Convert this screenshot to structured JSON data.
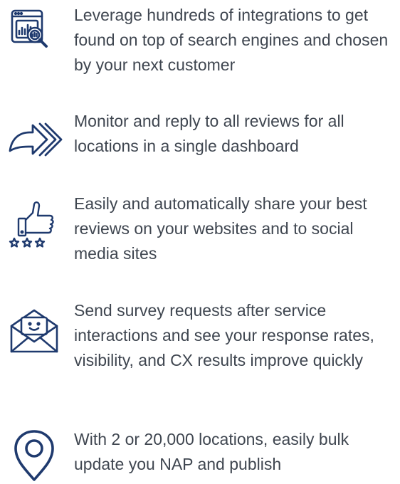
{
  "features": [
    {
      "icon": "analytics-search-icon",
      "text": "Leverage hundreds of integrations to get found on top of search engines and chosen by your next customer"
    },
    {
      "icon": "reply-arrow-icon",
      "text": "Monitor and reply to all reviews for all locations in a single dashboard"
    },
    {
      "icon": "thumbs-up-stars-icon",
      "text": "Easily and automatically share your best reviews on your websites and to social media sites"
    },
    {
      "icon": "survey-envelope-icon",
      "text": "Send survey requests after service interactions and see your response rates, visibility, and CX results improve quickly"
    },
    {
      "icon": "location-pin-icon",
      "text": "With 2 or 20,000 locations, easily bulk update you NAP and publish"
    }
  ],
  "colors": {
    "icon": "#1f3a6e",
    "text": "#3f4650",
    "background": "#ffffff"
  }
}
